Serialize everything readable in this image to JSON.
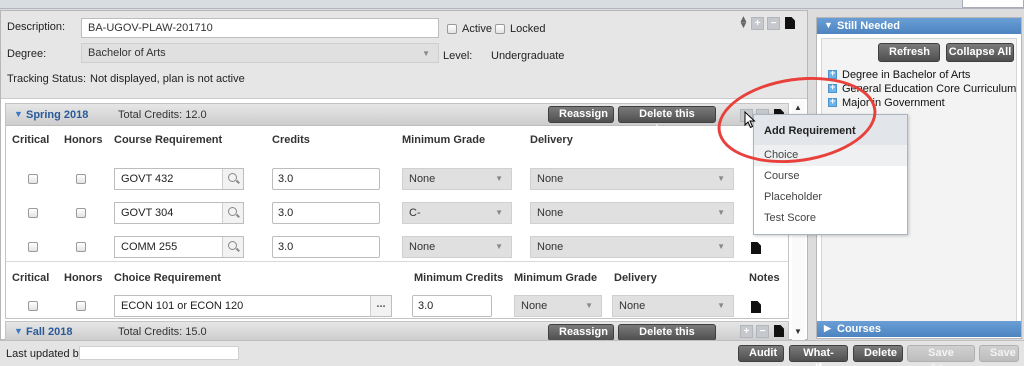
{
  "plan": {
    "description_label": "Description:",
    "description_value": "BA-UGOV-PLAW-201710",
    "active_label": "Active",
    "locked_label": "Locked",
    "degree_label": "Degree:",
    "degree_value": "Bachelor of Arts",
    "level_label": "Level:",
    "level_value": "Undergraduate",
    "tracking_label": "Tracking Status:",
    "tracking_value": "Not displayed, plan is not active"
  },
  "term1": {
    "name": "Spring 2018",
    "credits_text": "Total Credits: 12.0",
    "reassign_label": "Reassign",
    "delete_label": "Delete this term",
    "columns": {
      "critical": "Critical",
      "honors": "Honors",
      "course_req": "Course Requirement",
      "credits": "Credits",
      "min_grade": "Minimum Grade",
      "delivery": "Delivery"
    },
    "courses": [
      {
        "course": "GOVT 432",
        "credits": "3.0",
        "min_grade": "None",
        "delivery": "None"
      },
      {
        "course": "GOVT 304",
        "credits": "3.0",
        "min_grade": "C-",
        "delivery": "None"
      },
      {
        "course": "COMM 255",
        "credits": "3.0",
        "min_grade": "None",
        "delivery": "None"
      }
    ],
    "choice_columns": {
      "critical": "Critical",
      "honors": "Honors",
      "choice_req": "Choice Requirement",
      "min_credits": "Minimum Credits",
      "min_grade": "Minimum Grade",
      "delivery": "Delivery",
      "notes": "Notes"
    },
    "choice": {
      "text": "ECON 101 or ECON 120",
      "button": "...",
      "min_credits": "3.0",
      "min_grade": "None",
      "delivery": "None"
    }
  },
  "term2": {
    "name": "Fall 2018",
    "credits_text": "Total Credits: 15.0",
    "reassign_label": "Reassign",
    "delete_label": "Delete this term"
  },
  "menu": {
    "title": "Add Requirement",
    "items": [
      "Choice",
      "Course",
      "Placeholder",
      "Test Score"
    ]
  },
  "still_needed": {
    "title": "Still Needed",
    "refresh_label": "Refresh",
    "collapse_label": "Collapse All",
    "items": [
      "Degree in Bachelor of Arts",
      "General Education Core Curriculum",
      "Major in Government"
    ]
  },
  "courses_panel": {
    "title": "Courses"
  },
  "footer": {
    "last_updated_label": "Last updated by:",
    "audit_label": "Audit",
    "whatif_label": "What-If",
    "delete_label": "Delete",
    "saveas_label": "Save As...",
    "save_label": "Save"
  },
  "icons": {
    "expand": "triangle-down-icon",
    "search": "magnifier-icon",
    "notes": "document-icon"
  },
  "colors": {
    "term_title": "#2b5a9a",
    "panel_header": "#4d84c0",
    "highlight": "#e8413c"
  }
}
